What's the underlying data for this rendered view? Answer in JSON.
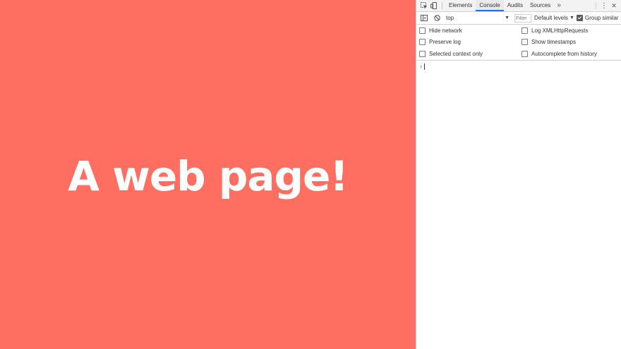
{
  "page": {
    "heading": "A web page!",
    "background": "#ff6f61",
    "text_color": "#ffffff"
  },
  "devtools": {
    "toolbar_icons": [
      "inspect-element-icon",
      "device-toolbar-icon"
    ],
    "tabs": [
      {
        "label": "Elements",
        "active": false
      },
      {
        "label": "Console",
        "active": true
      },
      {
        "label": "Audits",
        "active": false
      },
      {
        "label": "Sources",
        "active": false
      }
    ],
    "overflow_label": "»",
    "menu_label": "⋮",
    "close_label": "✕",
    "console_toolbar": {
      "context": "top",
      "filter_placeholder": "Filter",
      "levels_label": "Default levels",
      "group_similar_label": "Group similar",
      "group_similar_checked": true
    },
    "settings": {
      "left": [
        {
          "label": "Hide network",
          "checked": false
        },
        {
          "label": "Preserve log",
          "checked": false
        },
        {
          "label": "Selected context only",
          "checked": false
        }
      ],
      "right": [
        {
          "label": "Log XMLHttpRequests",
          "checked": false
        },
        {
          "label": "Show timestamps",
          "checked": false
        },
        {
          "label": "Autocomplete from history",
          "checked": false
        }
      ]
    },
    "prompt_symbol": "›",
    "accent": "#1a73e8"
  }
}
